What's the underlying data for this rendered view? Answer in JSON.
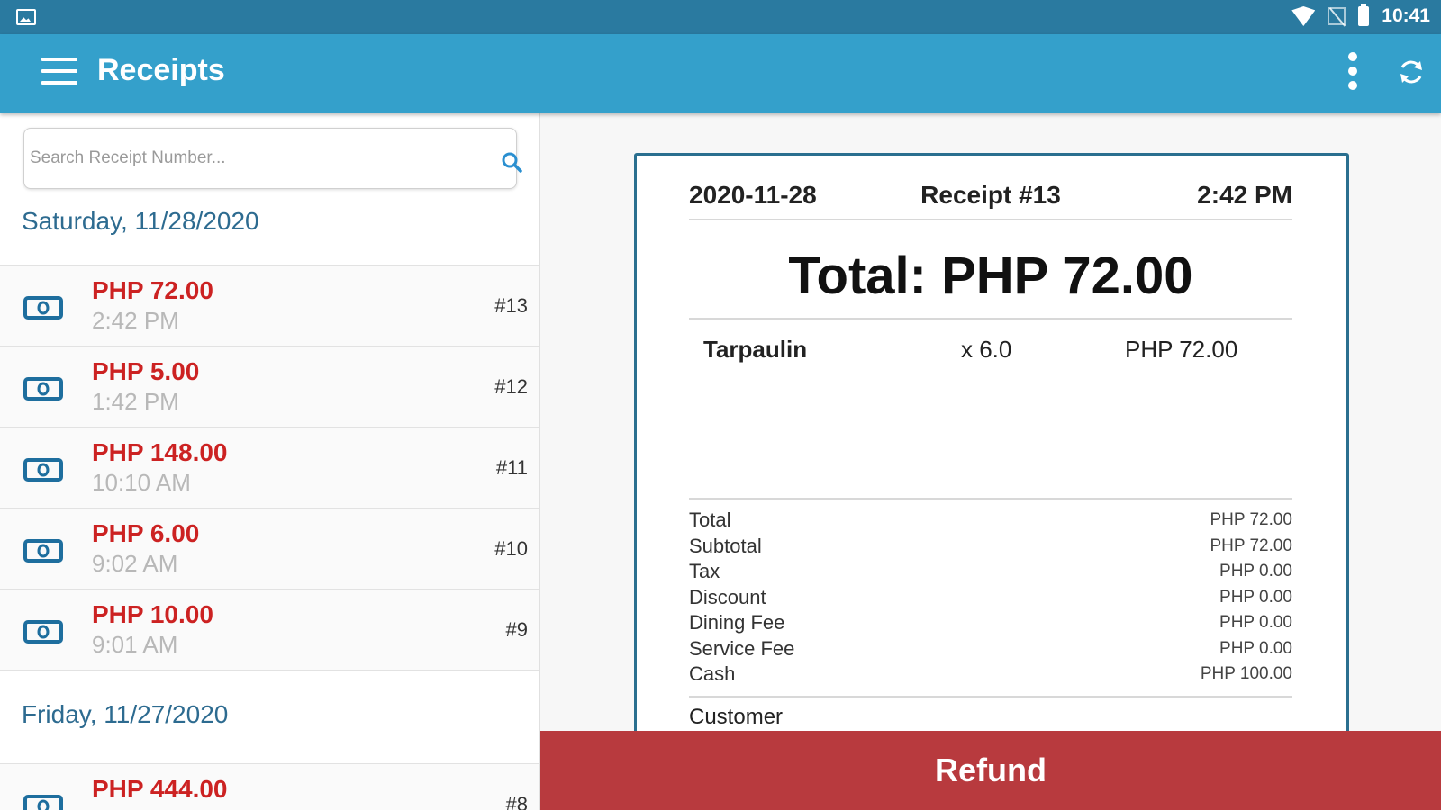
{
  "status_bar": {
    "time": "10:41"
  },
  "app_bar": {
    "title": "Receipts"
  },
  "search": {
    "placeholder": "Search Receipt Number..."
  },
  "groups": [
    {
      "date": "Saturday, 11/28/2020",
      "receipts": [
        {
          "amount": "PHP 72.00",
          "time": "2:42 PM",
          "number": "#13"
        },
        {
          "amount": "PHP 5.00",
          "time": "1:42 PM",
          "number": "#12"
        },
        {
          "amount": "PHP 148.00",
          "time": "10:10 AM",
          "number": "#11"
        },
        {
          "amount": "PHP 6.00",
          "time": "9:02 AM",
          "number": "#10"
        },
        {
          "amount": "PHP 10.00",
          "time": "9:01 AM",
          "number": "#9"
        }
      ]
    },
    {
      "date": "Friday, 11/27/2020",
      "receipts": [
        {
          "amount": "PHP 444.00",
          "time": "",
          "number": "#8"
        }
      ]
    }
  ],
  "receipt": {
    "date": "2020-11-28",
    "number_label": "Receipt #13",
    "time": "2:42 PM",
    "total_label": "Total: PHP 72.00",
    "items": [
      {
        "name": "Tarpaulin",
        "qty": "x 6.0",
        "price": "PHP 72.00"
      }
    ],
    "summary": [
      {
        "label": "Total",
        "value": "PHP 72.00"
      },
      {
        "label": "Subtotal",
        "value": "PHP 72.00"
      },
      {
        "label": "Tax",
        "value": "PHP 0.00"
      },
      {
        "label": "Discount",
        "value": "PHP 0.00"
      },
      {
        "label": "Dining Fee",
        "value": "PHP 0.00"
      },
      {
        "label": "Service Fee",
        "value": "PHP 0.00"
      },
      {
        "label": "Cash",
        "value": "PHP 100.00"
      }
    ],
    "customer_label": "Customer"
  },
  "refund_label": "Refund",
  "colors": {
    "app_bar": "#34a0cb",
    "status_bar": "#2a7aa0",
    "amount": "#cc2222",
    "refund": "#b83a3e"
  }
}
